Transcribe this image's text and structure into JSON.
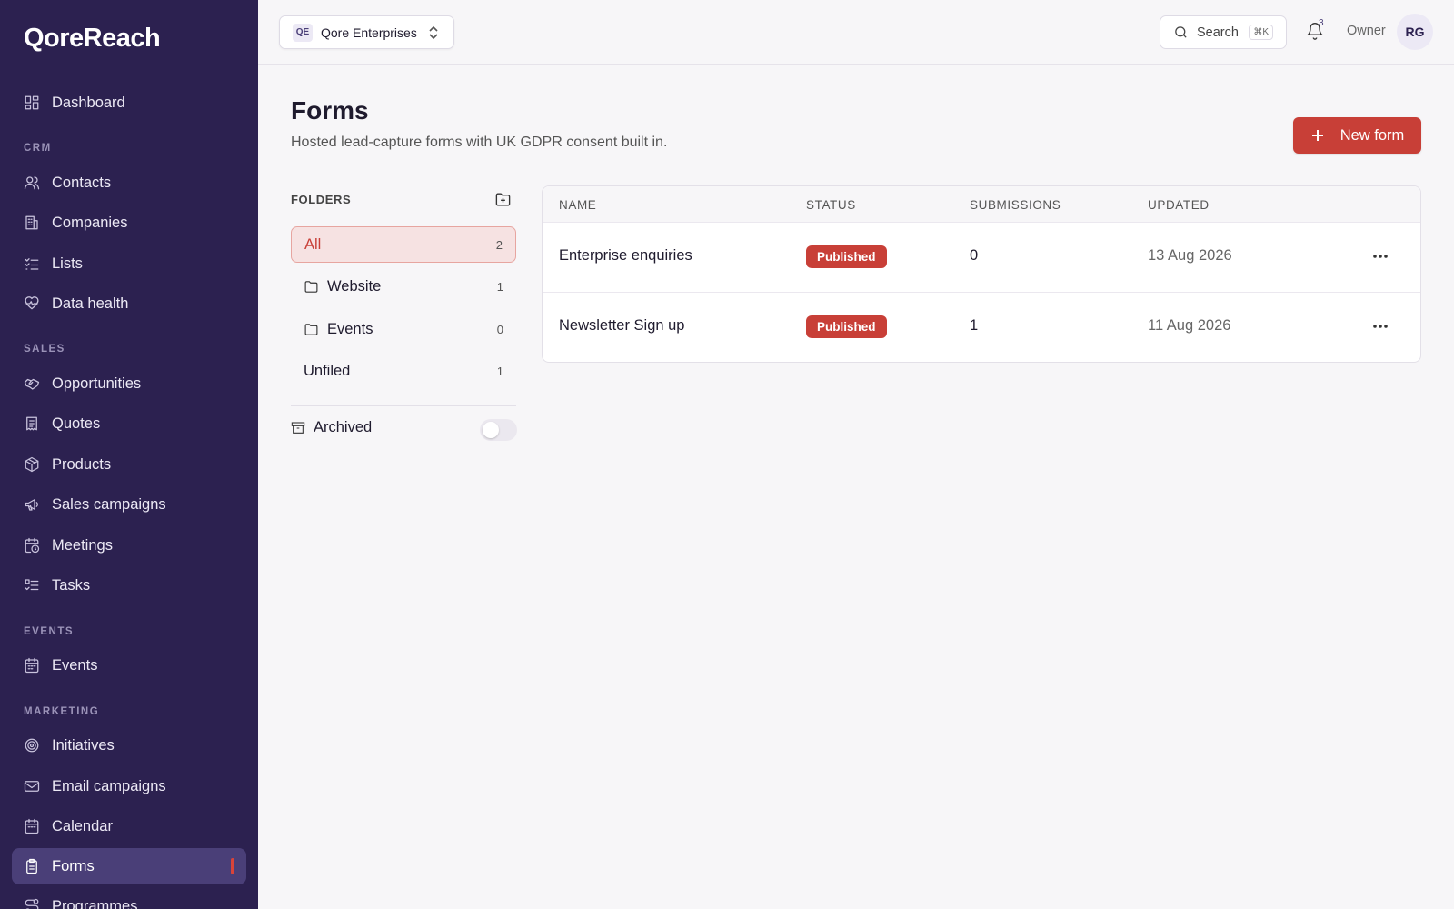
{
  "app": {
    "logo": "QoreReach"
  },
  "sidebar": {
    "sections": {
      "crm": "CRM",
      "sales": "SALES",
      "events": "EVENTS",
      "marketing": "MARKETING"
    },
    "items": {
      "dashboard": "Dashboard",
      "contacts": "Contacts",
      "companies": "Companies",
      "lists": "Lists",
      "data_health": "Data health",
      "opportunities": "Opportunities",
      "quotes": "Quotes",
      "products": "Products",
      "sales_campaigns": "Sales campaigns",
      "meetings": "Meetings",
      "tasks": "Tasks",
      "events": "Events",
      "initiatives": "Initiatives",
      "email_campaigns": "Email campaigns",
      "calendar": "Calendar",
      "forms": "Forms",
      "programmes": "Programmes"
    },
    "active_item": "Forms"
  },
  "topbar": {
    "org_badge": "QE",
    "org_name": "Qore Enterprises",
    "search_label": "Search",
    "search_shortcut": "⌘K",
    "notification_count": "3",
    "role": "Owner",
    "avatar_initials": "RG"
  },
  "page": {
    "title": "Forms",
    "subtitle": "Hosted lead-capture forms with UK GDPR consent built in.",
    "new_button": "New form"
  },
  "folders": {
    "heading": "FOLDERS",
    "items": [
      {
        "label": "All",
        "count": "2",
        "active": true
      },
      {
        "label": "Website",
        "count": "1"
      },
      {
        "label": "Events",
        "count": "0"
      },
      {
        "label": "Unfiled",
        "count": "1"
      }
    ],
    "archived_label": "Archived",
    "archived_on": false
  },
  "table": {
    "headers": {
      "name": "NAME",
      "status": "STATUS",
      "submissions": "SUBMISSIONS",
      "updated": "UPDATED"
    },
    "rows": [
      {
        "name": "Enterprise enquiries",
        "status": "Published",
        "submissions": "0",
        "updated": "13 Aug 2026"
      },
      {
        "name": "Newsletter Sign up",
        "status": "Published",
        "submissions": "1",
        "updated": "11 Aug 2026"
      }
    ]
  },
  "colors": {
    "sidebar_bg": "#2c2150",
    "accent": "#c83f37",
    "active_nav": "#4a3f78"
  }
}
